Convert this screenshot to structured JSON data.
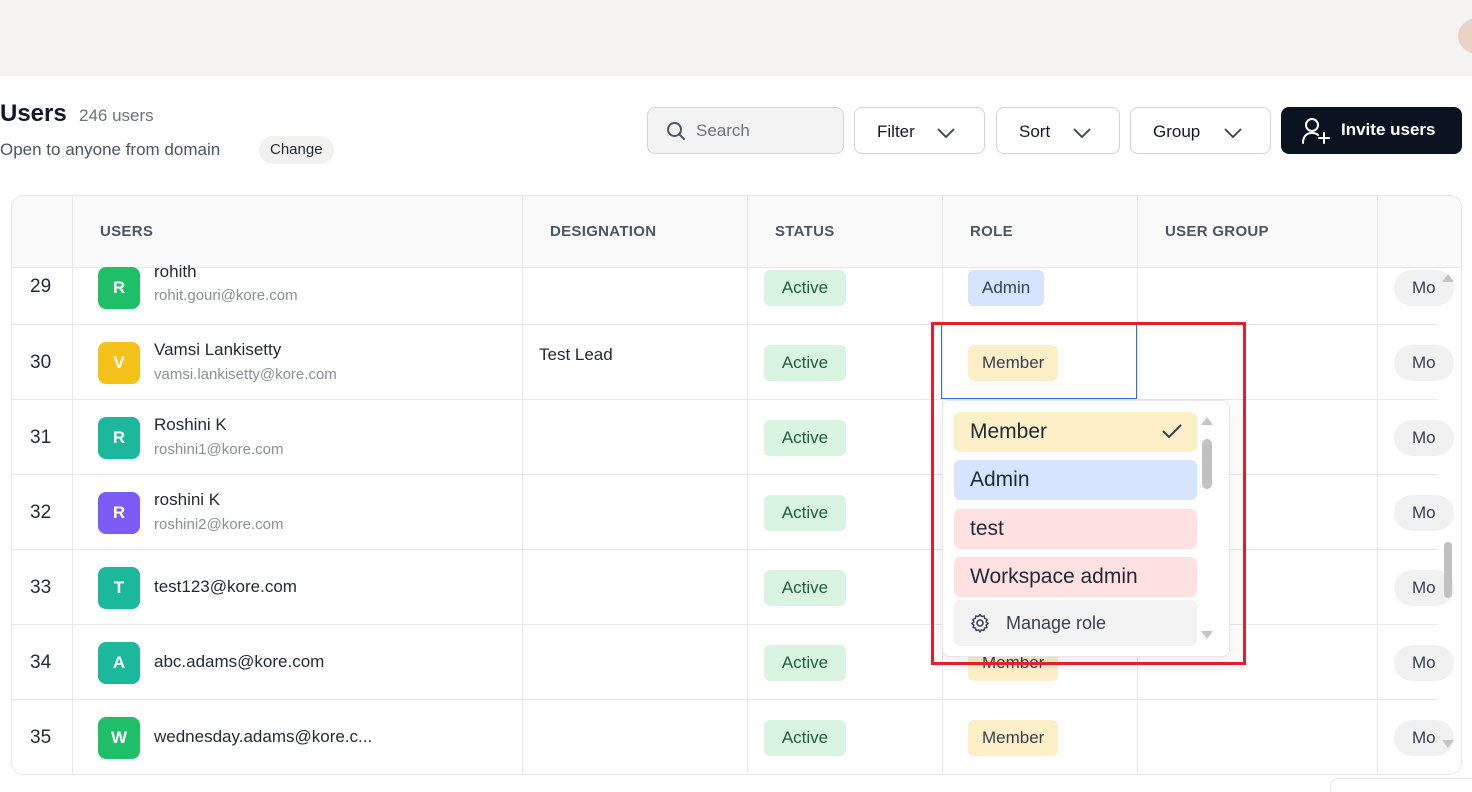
{
  "header": {
    "title": "Users",
    "count": "246 users",
    "domain_text": "Open to anyone from domain",
    "change_label": "Change"
  },
  "toolbar": {
    "search_placeholder": "Search",
    "filter_label": "Filter",
    "sort_label": "Sort",
    "group_label": "Group",
    "invite_label": "Invite users"
  },
  "table": {
    "columns": [
      "USERS",
      "DESIGNATION",
      "STATUS",
      "ROLE",
      "USER GROUP"
    ],
    "rows": [
      {
        "num": "29",
        "initial": "R",
        "color": "#1fbf67",
        "name": "rohith",
        "email": "rohit.gouri@kore.com",
        "designation": "",
        "status": "Active",
        "role": "Admin",
        "role_type": "admin",
        "more": "Mo"
      },
      {
        "num": "30",
        "initial": "V",
        "color": "#f5c21b",
        "name": "Vamsi Lankisetty",
        "email": "vamsi.lankisetty@kore.com",
        "designation": "Test Lead",
        "status": "Active",
        "role": "Member",
        "role_type": "member",
        "more": "Mo"
      },
      {
        "num": "31",
        "initial": "R",
        "color": "#1cb89c",
        "name": "Roshini K",
        "email": "roshini1@kore.com",
        "designation": "",
        "status": "Active",
        "role": "",
        "role_type": "",
        "more": "Mo"
      },
      {
        "num": "32",
        "initial": "R",
        "color": "#7b5cf5",
        "name": "roshini K",
        "email": "roshini2@kore.com",
        "designation": "",
        "status": "Active",
        "role": "",
        "role_type": "",
        "more": "Mo"
      },
      {
        "num": "33",
        "initial": "T",
        "color": "#1cb89c",
        "name": "test123@kore.com",
        "email": "",
        "designation": "",
        "status": "Active",
        "role": "",
        "role_type": "",
        "more": "Mo"
      },
      {
        "num": "34",
        "initial": "A",
        "color": "#1cb89c",
        "name": "abc.adams@kore.com",
        "email": "",
        "designation": "",
        "status": "Active",
        "role": "Member",
        "role_type": "member",
        "more": "Mo"
      },
      {
        "num": "35",
        "initial": "W",
        "color": "#1fbf67",
        "name": "wednesday.adams@kore.c...",
        "email": "",
        "designation": "",
        "status": "Active",
        "role": "Member",
        "role_type": "member",
        "more": "Mo"
      }
    ]
  },
  "role_dropdown": {
    "options": [
      "Member",
      "Admin",
      "test",
      "Workspace admin"
    ],
    "selected": "Member",
    "manage_label": "Manage role"
  },
  "icons": {
    "search": "search-icon",
    "chevron": "chevron-down-icon",
    "invite": "user-plus-icon",
    "check": "check-icon",
    "gear": "gear-icon"
  }
}
